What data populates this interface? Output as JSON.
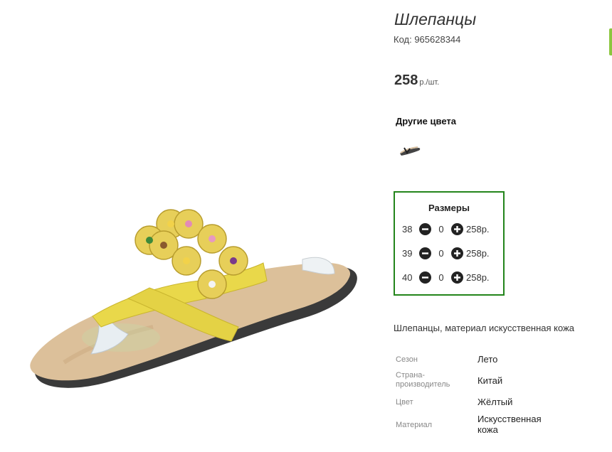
{
  "product": {
    "title": "Шлепанцы",
    "code": "Код: 965628344",
    "price_value": "258",
    "price_unit": "р./шт."
  },
  "other_colors": {
    "title": "Другие цвета"
  },
  "sizes": {
    "title": "Размеры",
    "rows": [
      {
        "size": "38",
        "qty": "0",
        "price": "258р."
      },
      {
        "size": "39",
        "qty": "0",
        "price": "258р."
      },
      {
        "size": "40",
        "qty": "0",
        "price": "258р."
      }
    ]
  },
  "description": "Шлепанцы, материал искусственная кожа",
  "specs": [
    {
      "label": "Сезон",
      "value": "Лето"
    },
    {
      "label": "Страна-производитель",
      "value": "Китай"
    },
    {
      "label": "Цвет",
      "value": "Жёлтый"
    },
    {
      "label": "Материал",
      "value": "Искусственная кожа"
    }
  ],
  "colors": {
    "sizes_border": "#23851b",
    "accent": "#8cc63f",
    "sandal_yellow": "#e9d84a",
    "sole_beige": "#dcc09a"
  }
}
